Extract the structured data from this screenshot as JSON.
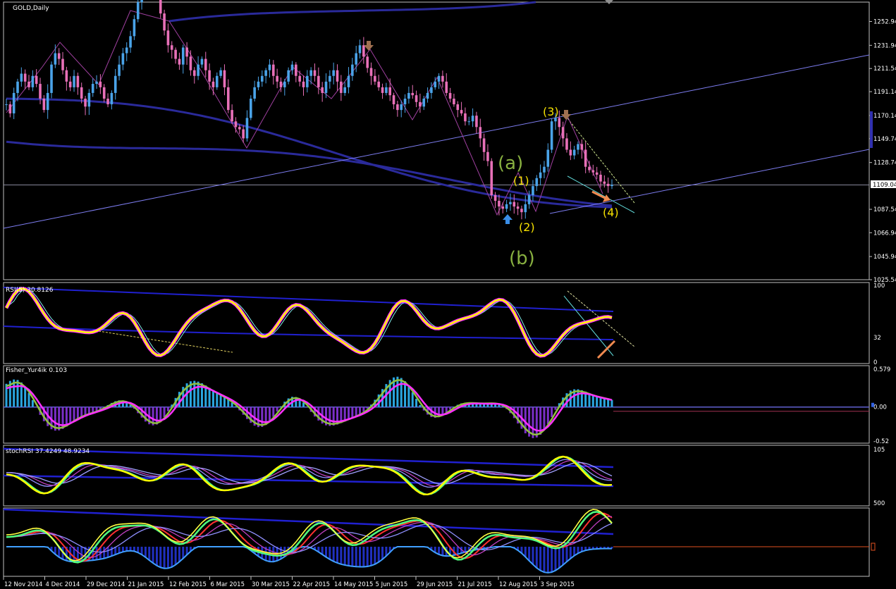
{
  "symbol_label": "GOLD,Daily",
  "current_price": "1109.04",
  "colors": {
    "background": "#000000",
    "frame": "#c0c0c0",
    "bull": "#4aa3e8",
    "bear": "#e870b8",
    "ma": "#2a2a9a",
    "channel": "#7d7df0",
    "wave_label": "#f5e000",
    "abc_label": "#88b040",
    "rsi_main": "#ffff00",
    "fisher_pos": "#2aa6e0",
    "fisher_neg": "#7b2fc8",
    "stoch_main": "#ffff00"
  },
  "chart_data": [
    {
      "type": "candlestick",
      "title": "GOLD,Daily",
      "ylim": [
        1025.54,
        1270
      ],
      "y_ticks": [
        "1252.94",
        "1231.94",
        "1211.54",
        "1191.14",
        "1170.14",
        "1149.74",
        "1128.74",
        "1109.04",
        "1087.54",
        "1066.94",
        "1045.94",
        "1025.54"
      ],
      "x_ticks": [
        "12 Nov 2014",
        "4 Dec 2014",
        "29 Dec 2014",
        "21 Jan 2015",
        "12 Feb 2015",
        "6 Mar 2015",
        "30 Mar 2015",
        "22 Apr 2015",
        "14 May 2015",
        "5 Jun 2015",
        "29 Jun 2015",
        "21 Jul 2015",
        "12 Aug 2015",
        "3 Sep 2015"
      ],
      "candles_close": [
        1180,
        1172,
        1190,
        1200,
        1207,
        1200,
        1195,
        1205,
        1198,
        1185,
        1175,
        1190,
        1215,
        1225,
        1220,
        1210,
        1200,
        1195,
        1205,
        1195,
        1185,
        1178,
        1190,
        1198,
        1200,
        1195,
        1185,
        1180,
        1190,
        1205,
        1215,
        1225,
        1230,
        1240,
        1255,
        1270,
        1280,
        1290,
        1298,
        1288,
        1275,
        1260,
        1245,
        1232,
        1228,
        1220,
        1215,
        1230,
        1222,
        1210,
        1205,
        1215,
        1220,
        1210,
        1200,
        1195,
        1205,
        1210,
        1195,
        1175,
        1165,
        1160,
        1158,
        1150,
        1168,
        1185,
        1195,
        1200,
        1205,
        1210,
        1215,
        1205,
        1200,
        1195,
        1200,
        1210,
        1215,
        1205,
        1200,
        1195,
        1205,
        1210,
        1205,
        1195,
        1190,
        1200,
        1205,
        1210,
        1200,
        1190,
        1195,
        1205,
        1215,
        1225,
        1232,
        1222,
        1212,
        1205,
        1200,
        1195,
        1190,
        1195,
        1188,
        1180,
        1175,
        1180,
        1185,
        1190,
        1188,
        1182,
        1178,
        1185,
        1190,
        1195,
        1200,
        1205,
        1200,
        1190,
        1185,
        1180,
        1175,
        1172,
        1165,
        1165,
        1170,
        1160,
        1150,
        1138,
        1130,
        1100,
        1095,
        1090,
        1088,
        1092,
        1094,
        1090,
        1088,
        1085,
        1092,
        1100,
        1108,
        1115,
        1120,
        1125,
        1140,
        1165,
        1168,
        1160,
        1150,
        1140,
        1135,
        1140,
        1145,
        1140,
        1125,
        1122,
        1120,
        1118,
        1112,
        1110,
        1108,
        1109
      ],
      "wave_labels": [
        "(a)",
        "(b)",
        "(1)",
        "(2)",
        "(3)",
        "(4)"
      ]
    },
    {
      "type": "line",
      "title": "RSI(5) 30.8126",
      "ylim": [
        0,
        100
      ],
      "y_ticks": [
        "100",
        "32",
        "0"
      ],
      "last_value": 30.8126
    },
    {
      "type": "bar",
      "title": "Fisher_Yur4ik 0.103",
      "ylim": [
        -0.52,
        0.579
      ],
      "y_ticks": [
        "0.579",
        "0.00",
        "-0.52"
      ],
      "last_value": 0.103
    },
    {
      "type": "line",
      "title": "stochRSI 37.4249 48.9234",
      "ylim": [
        0,
        105
      ],
      "y_ticks": [
        "105",
        "500"
      ],
      "values": [
        37.4249,
        48.9234
      ]
    },
    {
      "type": "line",
      "title": "",
      "y_ticks": []
    }
  ]
}
